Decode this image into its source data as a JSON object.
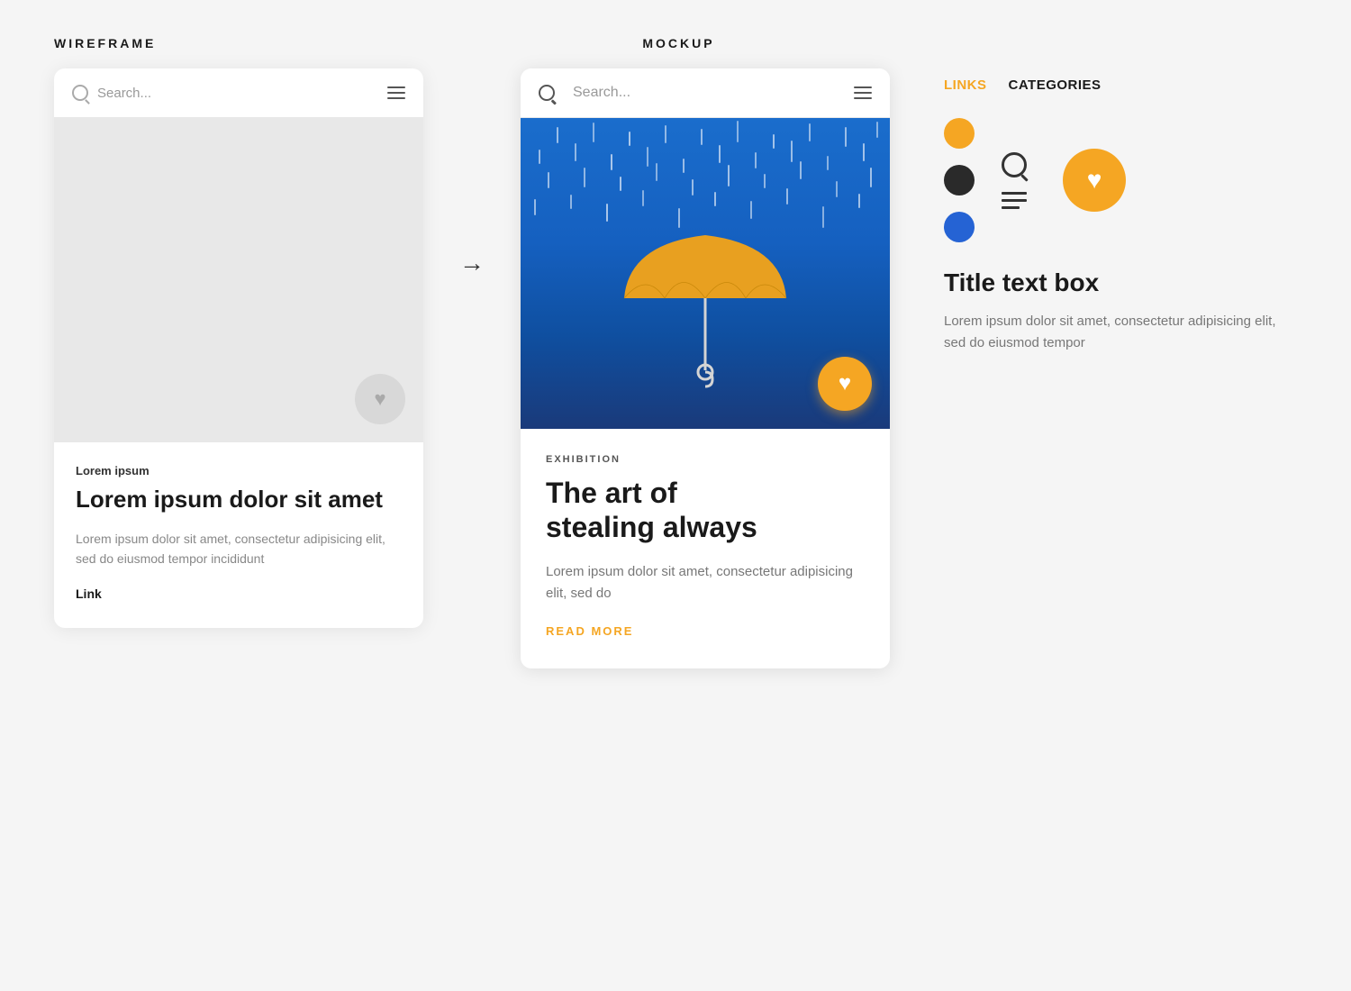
{
  "wireframe_label": "WIREFRAME",
  "mockup_label": "MOCKUP",
  "wireframe": {
    "search_placeholder": "Search...",
    "category": "Lorem ipsum",
    "title": "Lorem ipsum dolor sit amet",
    "body": "Lorem ipsum dolor sit amet, consectetur adipisicing elit, sed do eiusmod tempor incididunt",
    "link": "Link"
  },
  "mockup": {
    "search_placeholder": "Search...",
    "category": "EXHIBITION",
    "title_line1": "The art of",
    "title_line2": "stealing always",
    "body": "Lorem ipsum dolor sit amet, consectetur adipisicing elit, sed do",
    "read_more": "READ MORE"
  },
  "panel": {
    "tab_links": "LINKS",
    "tab_categories": "CATEGORIES",
    "title_box": "Title text box",
    "body": "Lorem ipsum dolor sit amet, consectetur adipisicing elit, sed do eiusmod tempor"
  },
  "colors": {
    "yellow": "#F5A623",
    "black": "#2a2a2a",
    "blue": "#2563d4"
  }
}
